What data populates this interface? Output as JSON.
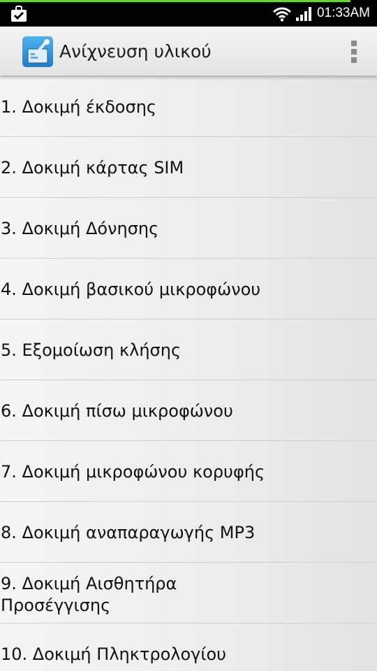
{
  "status_bar": {
    "time": "01:33AM",
    "icons": [
      "notification-check-icon",
      "wifi-icon",
      "signal-icon"
    ]
  },
  "action_bar": {
    "title": "Ανίχνευση υλικού",
    "app_icon": "hardware-test-app-icon",
    "menu_icon": "overflow-menu-icon"
  },
  "colors": {
    "status_bar_bg": "#000000",
    "progress_green": "#6fcf3a",
    "action_bar_bg": "#ececec",
    "text": "#111111",
    "divider": "#cfcfcf"
  },
  "tests": [
    {
      "label": "1. Δοκιμή έκδοσης"
    },
    {
      "label": "2. Δοκιμή κάρτας SIM"
    },
    {
      "label": "3. Δοκιμή Δόνησης"
    },
    {
      "label": "4. Δοκιμή βασικού μικροφώνου"
    },
    {
      "label": "5. Εξομοίωση κλήσης"
    },
    {
      "label": "6. Δοκιμή πίσω μικροφώνου"
    },
    {
      "label": "7. Δοκιμή μικροφώνου κορυφής"
    },
    {
      "label": "8. Δοκιμή αναπαραγωγής MP3"
    },
    {
      "label": "9. Δοκιμή Αισθητήρα Προσέγγισης"
    },
    {
      "label": "10. Δοκιμή Πληκτρολογίου"
    }
  ]
}
